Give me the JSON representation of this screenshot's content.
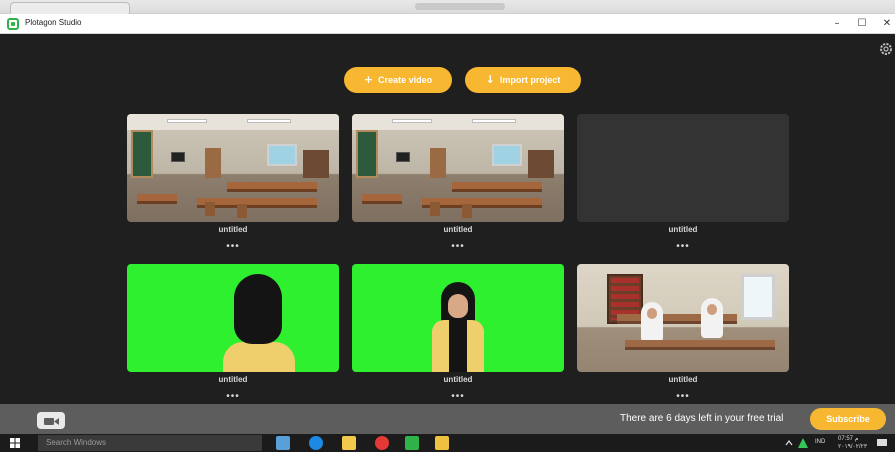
{
  "window": {
    "title": "Plotagon Studio",
    "minimize": "–",
    "maximize": "☐",
    "close": "✕"
  },
  "toolbar": {
    "create_video_label": "Create video",
    "import_project_label": "Import project"
  },
  "projects": [
    {
      "title": "untitled",
      "menu": "•••",
      "thumbnail": "classroom-scene"
    },
    {
      "title": "untitled",
      "menu": "•••",
      "thumbnail": "classroom-scene"
    },
    {
      "title": "untitled",
      "menu": "•••",
      "thumbnail": "empty"
    },
    {
      "title": "untitled",
      "menu": "•••",
      "thumbnail": "green-screen-character-back"
    },
    {
      "title": "untitled",
      "menu": "•••",
      "thumbnail": "green-screen-character-front"
    },
    {
      "title": "untitled",
      "menu": "•••",
      "thumbnail": "library-two-students"
    }
  ],
  "footer": {
    "trial_text": "There are 6 days left in your free trial",
    "subscribe_label": "Subscribe"
  },
  "taskbar": {
    "search_placeholder": "Search Windows",
    "language": "IND",
    "time": "07:57 م",
    "date": "٢٠١٩/٠٢/٢٣"
  },
  "colors": {
    "accent": "#f7b731",
    "background": "#1f1f1f",
    "footer": "#5d5d5d"
  }
}
